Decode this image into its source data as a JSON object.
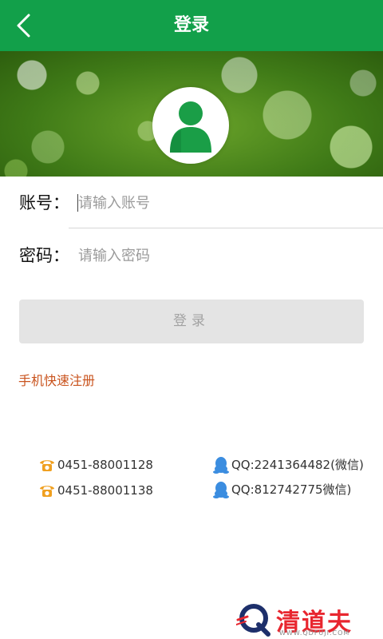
{
  "header": {
    "title": "登录",
    "back_icon": "chevron-left-icon",
    "color": "#12a04a"
  },
  "banner": {
    "avatar_icon": "user-avatar-icon",
    "avatar_color": "#1a9e47"
  },
  "form": {
    "account_label": "账号：",
    "account_placeholder": "请输入账号",
    "account_value": "",
    "password_label": "密码：",
    "password_placeholder": "请输入密码",
    "password_value": ""
  },
  "login_button": {
    "label": "登录",
    "enabled": false
  },
  "register_link": "手机快速注册",
  "contacts": [
    {
      "icon": "phone-icon",
      "text": "0451-88001128"
    },
    {
      "icon": "phone-icon",
      "text": "0451-88001138"
    },
    {
      "icon": "qq-icon",
      "text": "QQ:2241364482(微信)"
    },
    {
      "icon": "qq-icon",
      "text": "QQ:812742775微信)"
    }
  ],
  "watermark": {
    "brand": "清道夫",
    "url": "WWW.QDFUJI.COM"
  },
  "colors": {
    "accent_orange": "#c9531d",
    "phone_icon": "#f0a020",
    "qq_icon": "#3b8de0"
  }
}
